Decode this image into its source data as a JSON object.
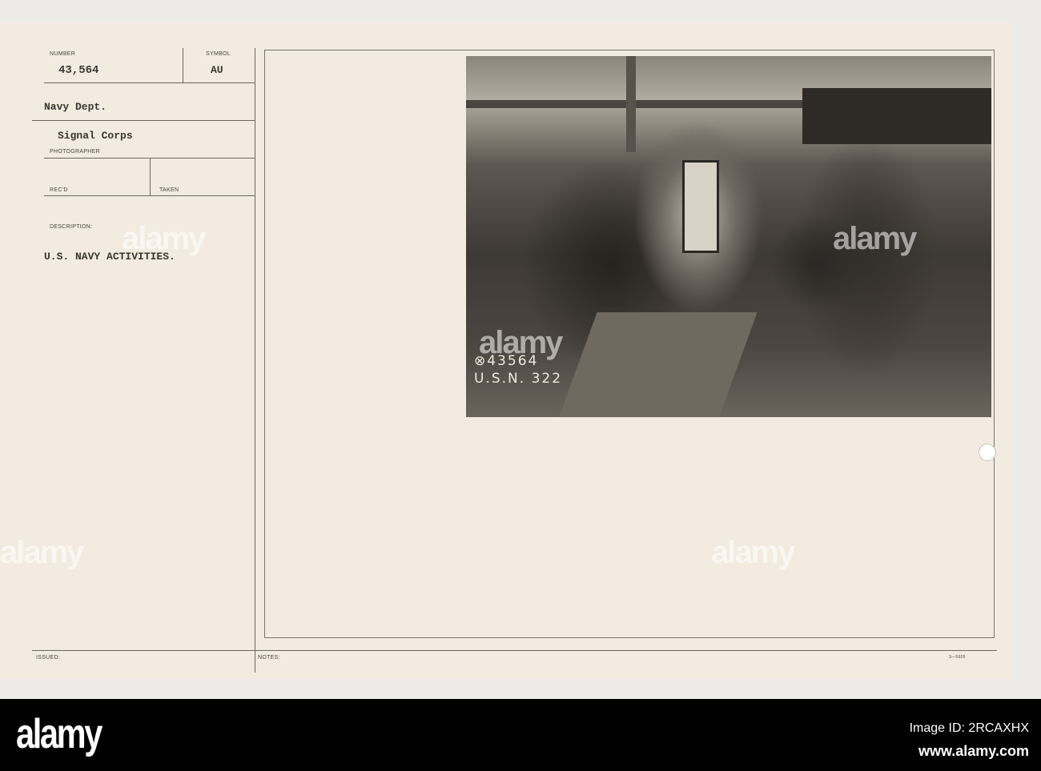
{
  "card": {
    "number_label": "NUMBER",
    "number": "43,564",
    "symbol_label": "SYMBOL",
    "symbol": "AU",
    "department": "Navy Dept.",
    "unit": "Signal Corps",
    "photographer_label": "PHOTOGRAPHER",
    "recd_label": "REC'D",
    "taken_label": "TAKEN",
    "description_label": "DESCRIPTION:",
    "description": "U.S. NAVY ACTIVITIES.",
    "issued_label": "ISSUED:",
    "notes_label": "NOTES:",
    "form_number": "3—5605"
  },
  "photo": {
    "caption_line1": "⊗43564",
    "caption_line2": "U.S.N. 322"
  },
  "watermark": "alamy",
  "footer": {
    "logo": "alamy",
    "image_id": "Image ID: 2RCAXHX",
    "url": "www.alamy.com"
  }
}
